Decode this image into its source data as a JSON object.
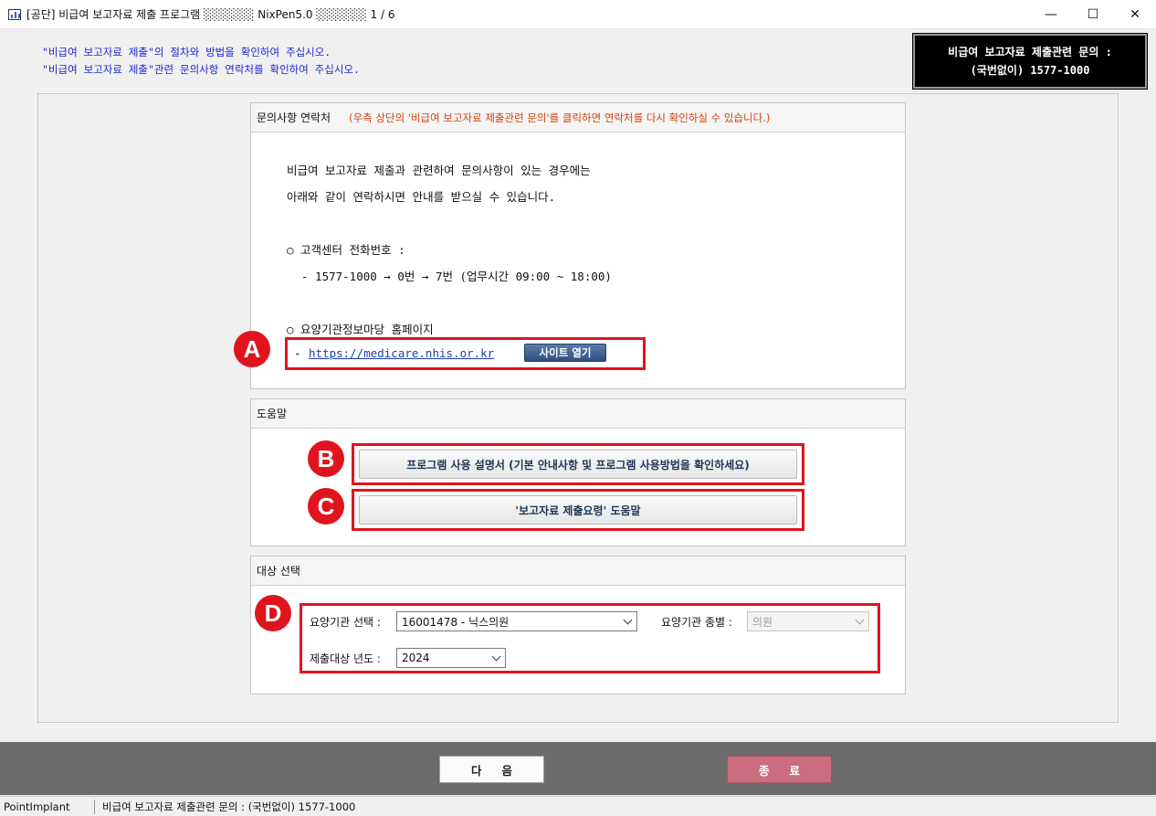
{
  "window": {
    "title": "[공단] 비급여 보고자료 제출 프로그램 ░░░░░░ NixPen5.0 ░░░░░░  1 / 6",
    "minimize_icon": "—",
    "maximize_icon": "☐",
    "close_icon": "✕"
  },
  "notice": {
    "line1": "\"비급여 보고자료 제출\"의 절차와 방법을 확인하여 주십시오.",
    "line2": "\"비급여 보고자료 제출\"관련 문의사항 연락처를 확인하여 주십시오."
  },
  "contact_box": {
    "line1": "비급여 보고자료 제출관련 문의 :",
    "line2": "(국번없이) 1577-1000"
  },
  "contact_group": {
    "title": "문의사항 연락처",
    "note": "(우측 상단의 '비급여 보고자료 제출관련 문의'를 클릭하면 연락처를 다시 확인하실 수 있습니다.)",
    "intro1": "비급여 보고자료 제출과 관련하여 문의사항이 있는 경우에는",
    "intro2": "아래와 같이 연락하시면 안내를 받으실 수 있습니다.",
    "phone_heading": "○ 고객센터 전화번호 :",
    "phone_detail": "- 1577-1000 → 0번 → 7번 (업무시간 09:00 ~ 18:00)",
    "site_heading": "○ 요양기관정보마당 홈페이지",
    "site_dash": "-",
    "site_url": "https://medicare.nhis.or.kr",
    "open_site_button": "사이트 열기"
  },
  "help_group": {
    "title": "도움말",
    "manual_button": "프로그램 사용 설명서 (기본 안내사항 및 프로그램 사용방법을 확인하세요)",
    "guide_button": "'보고자료 제출요령' 도움말"
  },
  "target_group": {
    "title": "대상 선택",
    "institution_label": "요양기관 선택 :",
    "institution_value": "16001478 - 닉스의원",
    "type_label": "요양기관 종별 :",
    "type_value": "의원",
    "year_label": "제출대상 년도 :",
    "year_value": "2024"
  },
  "annotations": {
    "a": "A",
    "b": "B",
    "c": "C",
    "d": "D",
    "color": "#e0141e"
  },
  "footer": {
    "next_button": "다음",
    "exit_button": "종료"
  },
  "statusbar": {
    "left": "PointImplant",
    "right": "비급여 보고자료 제출관련 문의 : (국번없이) 1577-1000"
  }
}
